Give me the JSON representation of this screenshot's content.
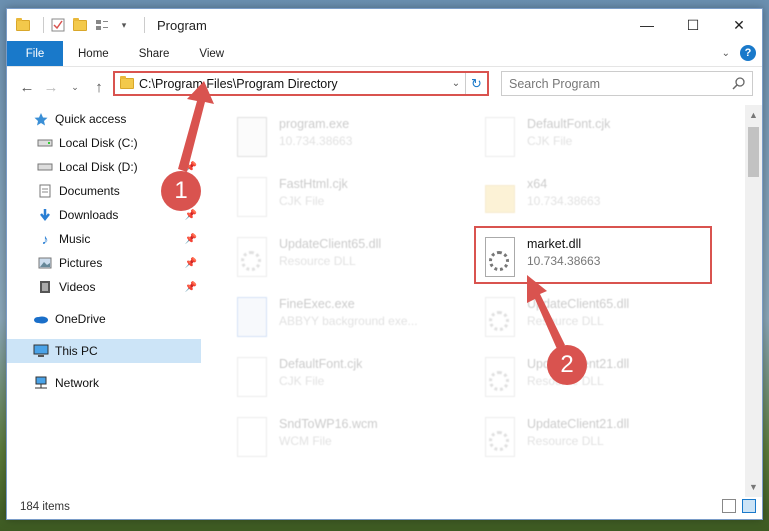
{
  "window": {
    "title": "Program",
    "controls": {
      "minimize": "—",
      "maximize": "☐",
      "close": "✕"
    }
  },
  "ribbon": {
    "tabs": [
      "File",
      "Home",
      "Share",
      "View"
    ],
    "help": "?"
  },
  "address": {
    "path": "C:\\Program Files\\Program Directory",
    "search_placeholder": "Search Program"
  },
  "sidebar": {
    "items": [
      {
        "label": "Quick access",
        "icon": "star-icon",
        "pinned": false
      },
      {
        "label": "Local Disk (C:)",
        "icon": "drive-icon",
        "pinned": false
      },
      {
        "label": "Local Disk (D:)",
        "icon": "drive-icon",
        "pinned": true
      },
      {
        "label": "Documents",
        "icon": "documents-icon",
        "pinned": true
      },
      {
        "label": "Downloads",
        "icon": "download-icon",
        "pinned": true
      },
      {
        "label": "Music",
        "icon": "music-icon",
        "pinned": true
      },
      {
        "label": "Pictures",
        "icon": "pictures-icon",
        "pinned": true
      },
      {
        "label": "Videos",
        "icon": "videos-icon",
        "pinned": true
      },
      {
        "label": "OneDrive",
        "icon": "cloud-icon",
        "pinned": false
      },
      {
        "label": "This PC",
        "icon": "computer-icon",
        "pinned": false
      },
      {
        "label": "Network",
        "icon": "network-icon",
        "pinned": false
      }
    ]
  },
  "files": [
    {
      "name": "program.exe",
      "sub": "10.734.38663",
      "faded": true
    },
    {
      "name": "DefaultFont.cjk",
      "sub": "CJK File",
      "faded": true
    },
    {
      "name": "FastHtml.cjk",
      "sub": "CJK File",
      "faded": true
    },
    {
      "name": "x64",
      "sub": "10.734.38663",
      "faded": true
    },
    {
      "name": "UpdateClient65.dll",
      "sub": "Resource DLL",
      "faded": true
    },
    {
      "name": "market.dll",
      "sub": "10.734.38663",
      "faded": false
    },
    {
      "name": "FineExec.exe",
      "sub": "ABBYY background exe...",
      "faded": true
    },
    {
      "name": "UpdateClient65.dll",
      "sub": "Resource DLL",
      "faded": true
    },
    {
      "name": "DefaultFont.cjk",
      "sub": "CJK File",
      "faded": true
    },
    {
      "name": "UpdateClient21.dll",
      "sub": "Resource DLL",
      "faded": true
    },
    {
      "name": "SndToWP16.wcm",
      "sub": "WCM File",
      "faded": true
    },
    {
      "name": "UpdateClient21.dll",
      "sub": "Resource DLL",
      "faded": true
    }
  ],
  "annotations": {
    "step1": "1",
    "step2": "2"
  },
  "status": {
    "item_count": "184 items"
  },
  "colors": {
    "accent": "#1979ca",
    "highlight": "#d9534f"
  }
}
